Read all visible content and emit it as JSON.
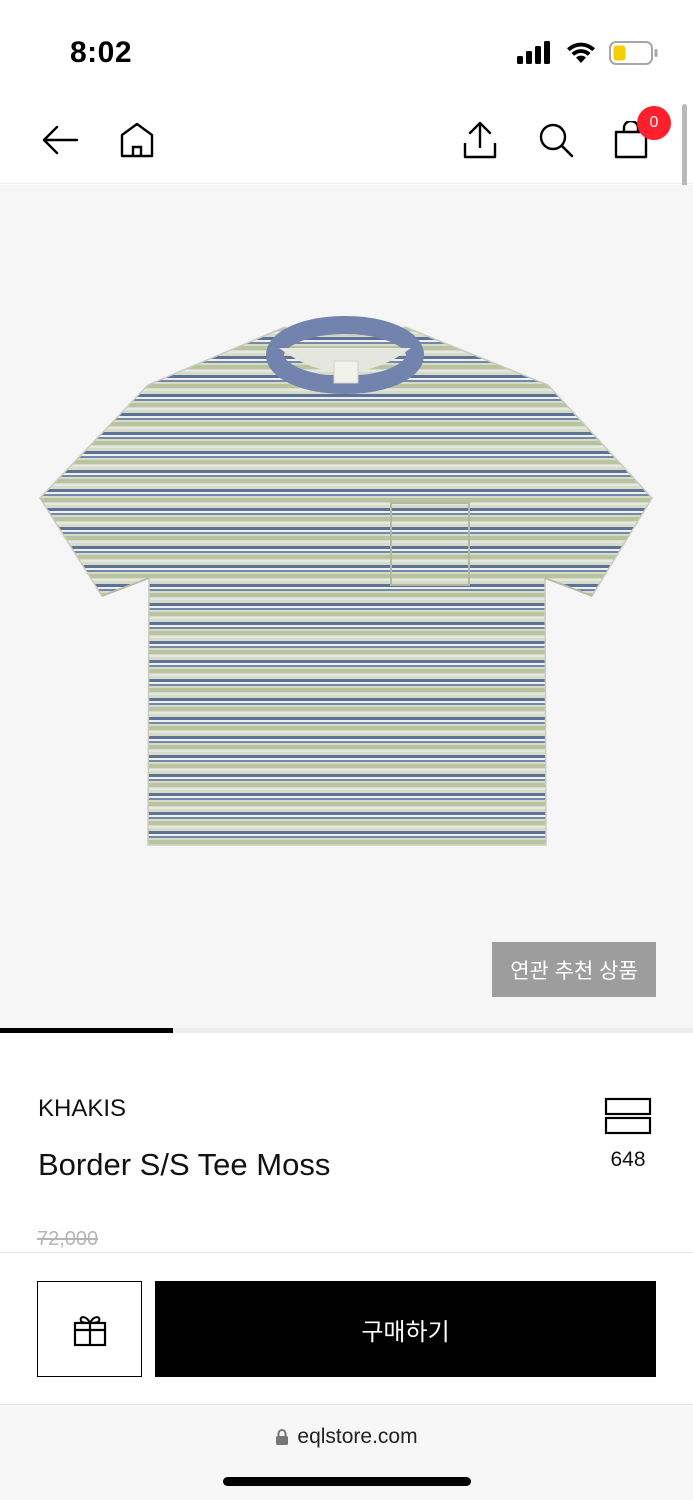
{
  "status": {
    "time": "8:02"
  },
  "nav": {
    "cart_count": "0"
  },
  "colors": {
    "accent_badge": "#ff1f2d",
    "buy_button": "#000000",
    "related_button": "#9d9d9d"
  },
  "gallery": {
    "related_label": "연관 추천 상품",
    "slide_progress": 0.25
  },
  "product": {
    "brand": "KHAKIS",
    "name": "Border S/S Tee Moss",
    "original_price": "72,000",
    "size_count": "648"
  },
  "actions": {
    "buy_label": "구매하기"
  },
  "browser": {
    "url": "eqlstore.com"
  },
  "icons": [
    "signal-icon",
    "wifi-icon",
    "battery-icon",
    "back-arrow-icon",
    "home-icon",
    "share-icon",
    "search-icon",
    "shopping-bag-icon",
    "size-guide-icon",
    "gift-icon",
    "lock-icon"
  ]
}
